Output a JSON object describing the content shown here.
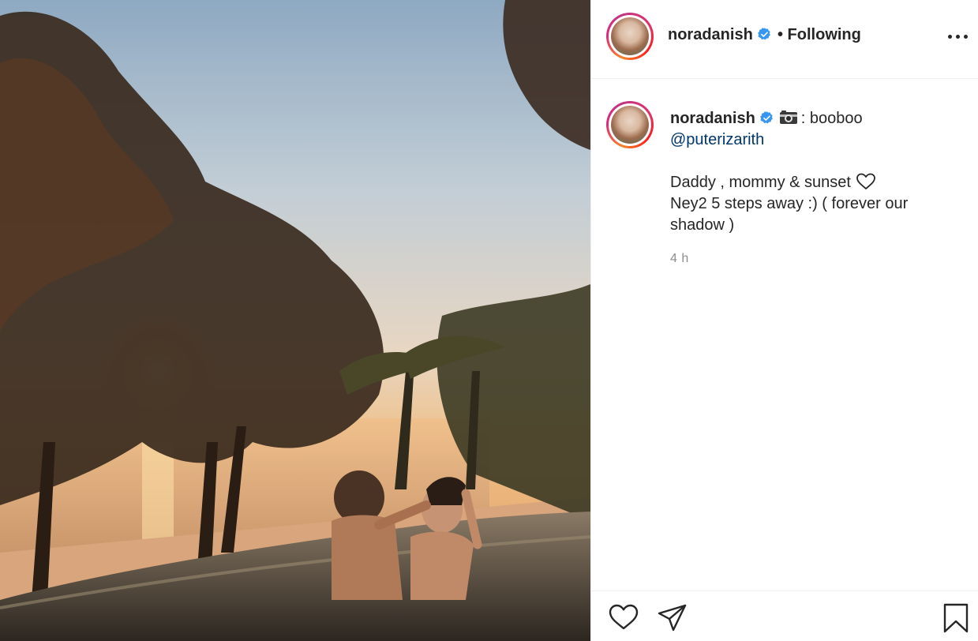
{
  "post": {
    "image_alt": "Couple in an infinity pool at sunset with trees, palm trees and beach",
    "header": {
      "username": "noradanish",
      "verified": true,
      "follow_status": "• Following",
      "more_icon": "more-horizontal-icon"
    },
    "caption": {
      "username": "noradanish",
      "emoji": "camera-emoji",
      "text_prefix": ": booboo",
      "mention": "@puterizarith",
      "line1": "Daddy , mommy & sunset",
      "body_rest": "Ney2 5 steps away :) ( forever our shadow )"
    },
    "timestamp": "4 h",
    "actions": {
      "like_icon": "heart-icon",
      "share_icon": "paper-plane-icon",
      "save_icon": "bookmark-icon"
    },
    "colors": {
      "verified_badge": "#3897f0",
      "mention": "#00376b",
      "timestamp": "#8e8e8e",
      "text": "#262626"
    }
  }
}
